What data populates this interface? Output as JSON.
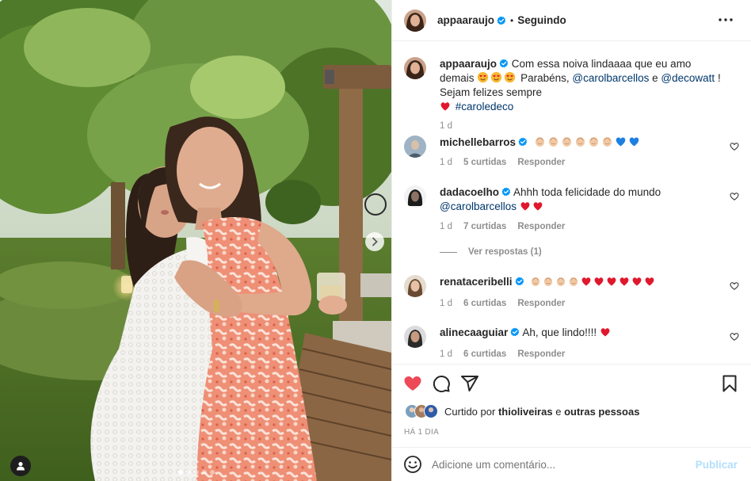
{
  "post": {
    "username": "appaaraujo",
    "following_label": "Seguindo",
    "separator": "•",
    "caption_username": "appaaraujo",
    "caption_part1": "Com essa noiva lindaaaa que eu amo demais",
    "caption_part2": "Parabéns,",
    "caption_mention1": "@carolbarcellos",
    "caption_and": "e",
    "caption_mention2": "@decowatt",
    "caption_part3": "! Sejam felizes sempre",
    "caption_hashtag": "#caroledeco",
    "caption_time": "1 d"
  },
  "comments": [
    {
      "username": "michellebarros",
      "text": "",
      "emojis": [
        "clap",
        "clap",
        "clap",
        "clap",
        "clap",
        "clap",
        "blue-heart",
        "blue-heart"
      ],
      "time": "1 d",
      "likes": "5 curtidas",
      "reply": "Responder"
    },
    {
      "username": "dadacoelho",
      "text": "Ahhh toda felicidade do mundo",
      "mention": "@carolbarcellos",
      "emojis": [
        "red-heart",
        "red-heart"
      ],
      "time": "1 d",
      "likes": "7 curtidas",
      "reply": "Responder",
      "view_replies": "Ver respostas (1)"
    },
    {
      "username": "renataceribelli",
      "text": "",
      "emojis": [
        "clap",
        "clap",
        "clap",
        "clap",
        "red-heart",
        "red-heart",
        "red-heart",
        "red-heart",
        "red-heart",
        "red-heart"
      ],
      "time": "1 d",
      "likes": "6 curtidas",
      "reply": "Responder"
    },
    {
      "username": "alinecaaguiar",
      "text": "Ah, que lindo!!!!",
      "emojis": [
        "red-heart"
      ],
      "time": "1 d",
      "likes": "6 curtidas",
      "reply": "Responder"
    }
  ],
  "actions": {
    "liked": true,
    "liked_by_prefix": "Curtido por",
    "liked_by_user": "thioliveiras",
    "liked_by_suffix": "e",
    "liked_by_others": "outras pessoas",
    "timestamp": "HÁ 1 DIA"
  },
  "add_comment": {
    "placeholder": "Adicione um comentário...",
    "publish_label": "Publicar"
  },
  "carousel": {
    "slide_count": 5,
    "active_slide": 1
  },
  "colors": {
    "like_red": "#ed4956",
    "verified_blue": "#0095f6",
    "mention_blue": "#00376b",
    "publish_disabled": "#b2dffc"
  }
}
